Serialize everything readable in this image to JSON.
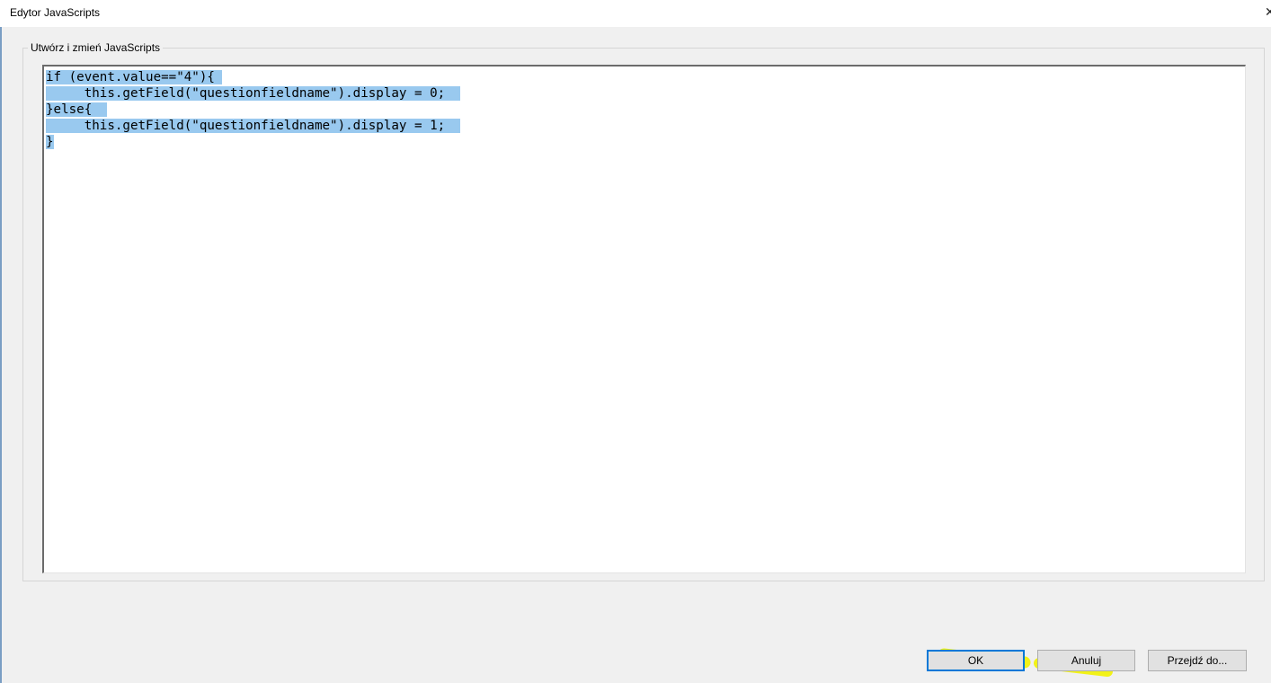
{
  "window": {
    "title": "Edytor JavaScripts",
    "close_glyph": "✕"
  },
  "group": {
    "label": "Utwórz i zmień JavaScripts"
  },
  "editor": {
    "selection_color": "#99c9ef",
    "lines": [
      "if (event.value==\"4\"){",
      "     this.getField(\"questionfieldname\").display = 0;",
      "}else{",
      "     this.getField(\"questionfieldname\").display = 1;",
      "}"
    ],
    "selection_trailing_spaces": [
      1,
      2,
      2,
      2,
      0
    ]
  },
  "buttons": {
    "ok": "OK",
    "cancel": "Anuluj",
    "goto": "Przejdź do..."
  },
  "annotation": {
    "marker_color": "#f2f200"
  }
}
